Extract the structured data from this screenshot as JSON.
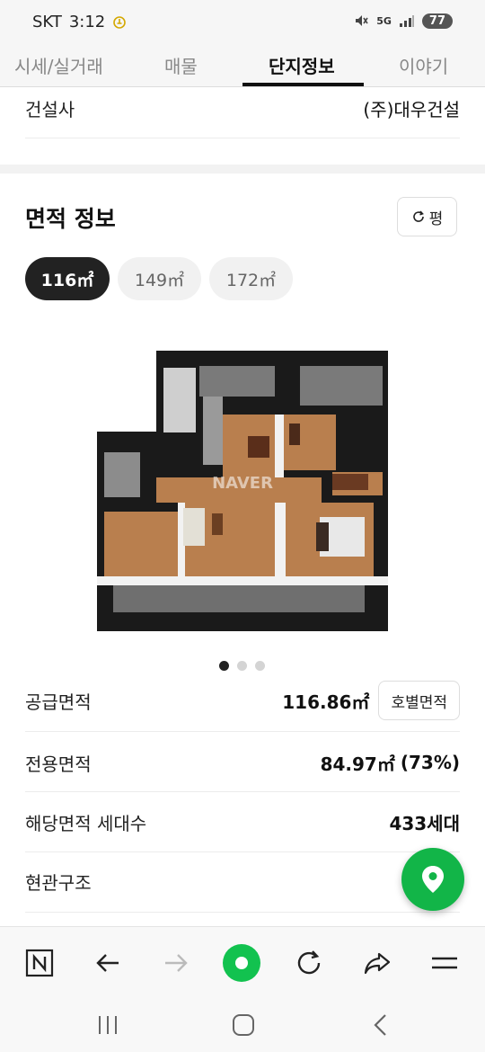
{
  "status": {
    "carrier": "SKT",
    "time": "3:12",
    "network": "5G",
    "battery": "77"
  },
  "tabs": [
    {
      "label": "시세/실거래",
      "active": false
    },
    {
      "label": "매물",
      "active": false
    },
    {
      "label": "단지정보",
      "active": true
    },
    {
      "label": "이야기",
      "active": false
    }
  ],
  "builder": {
    "label": "건설사",
    "value": "(주)대우건설"
  },
  "area_section": {
    "title": "면적 정보",
    "unit_toggle_label": "평",
    "chips": [
      {
        "label": "116㎡",
        "active": true
      },
      {
        "label": "149㎡",
        "active": false
      },
      {
        "label": "172㎡",
        "active": false
      }
    ],
    "watermark": "NAVER",
    "carousel": {
      "total": 3,
      "current": 1
    }
  },
  "info_rows": {
    "supply": {
      "label": "공급면적",
      "value": "116.86㎡",
      "button": "호별면적"
    },
    "exclusive": {
      "label": "전용면적",
      "value": "84.97㎡",
      "extra": "(73%)"
    },
    "households": {
      "label": "해당면적 세대수",
      "value": "433세대"
    },
    "entrance": {
      "label": "현관구조",
      "value": ""
    }
  },
  "colors": {
    "accent_green": "#12b548",
    "dark_chip": "#222222"
  },
  "toolbar_icons": [
    "naver-home-icon",
    "back-arrow-icon",
    "forward-arrow-icon",
    "green-dot-icon",
    "refresh-icon",
    "share-icon",
    "menu-icon"
  ],
  "nav_icons": [
    "recent-apps-icon",
    "home-icon",
    "back-icon"
  ]
}
